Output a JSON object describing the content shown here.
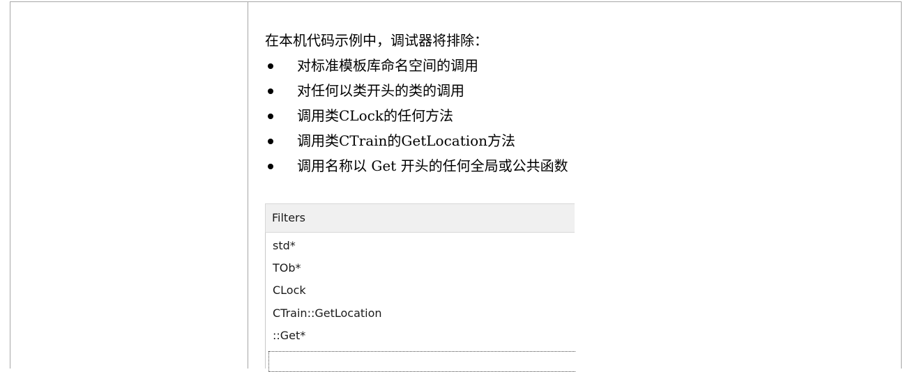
{
  "content": {
    "intro": "在本机代码示例中，调试器将排除：",
    "bullets": [
      "对标准模板库命名空间的调用",
      "对任何以类开头的类的调用",
      "调用类CLock的任何方法",
      "调用类CTrain的GetLocation方法",
      "调用名称以 Get 开头的任何全局或公共函数"
    ]
  },
  "filters": {
    "header": "Filters",
    "items": [
      "std*",
      "TOb*",
      "CLock",
      "CTrain::GetLocation",
      "::Get*"
    ],
    "selected_index": 4
  }
}
